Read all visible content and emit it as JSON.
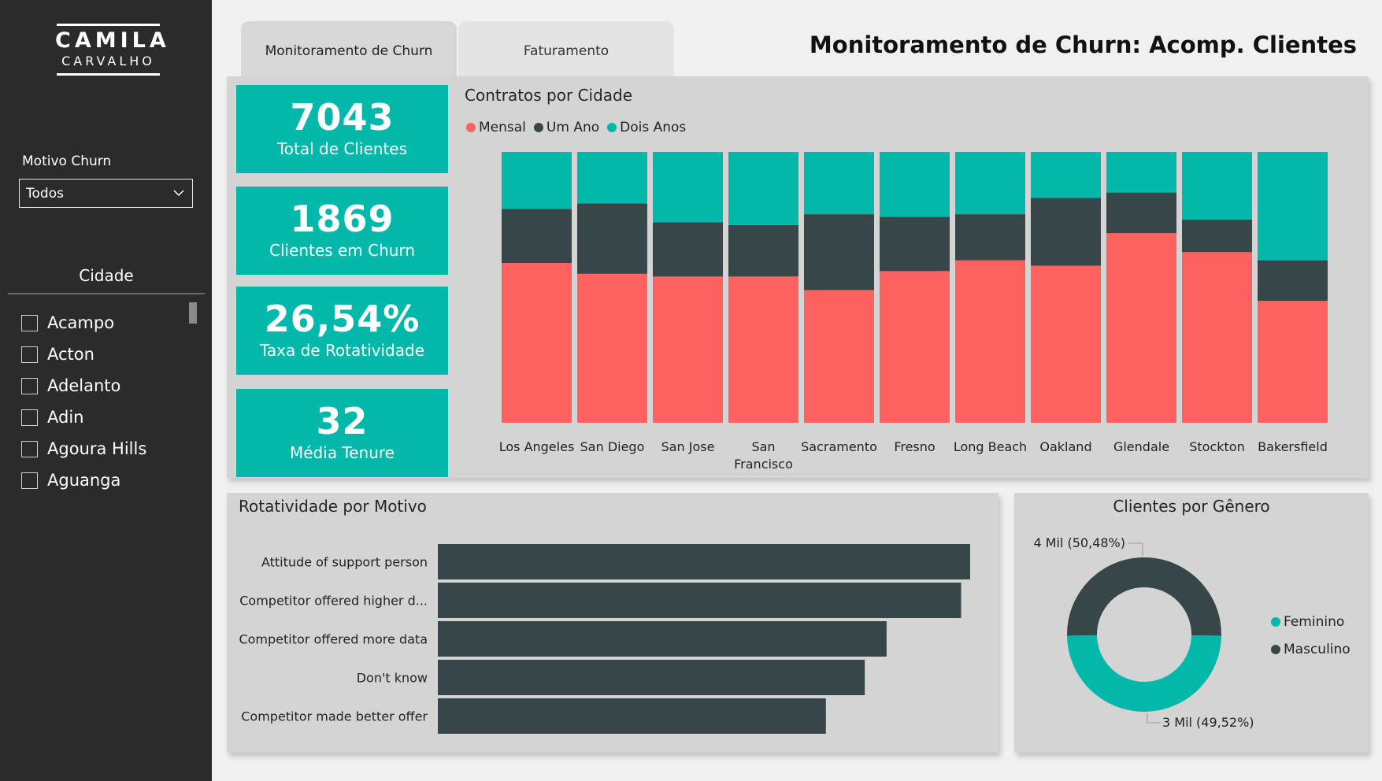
{
  "logo": {
    "line1": "CAMILA",
    "line2": "CARVALHO"
  },
  "filters": {
    "motivo_label": "Motivo Churn",
    "motivo_value": "Todos",
    "cidade_title": "Cidade",
    "cities": [
      "Acampo",
      "Acton",
      "Adelanto",
      "Adin",
      "Agoura Hills",
      "Aguanga"
    ]
  },
  "tabs": [
    {
      "label": "Monitoramento de Churn",
      "active": true
    },
    {
      "label": "Faturamento",
      "active": false
    }
  ],
  "page_title": "Monitoramento de Churn: Acomp. Clientes",
  "kpis": [
    {
      "value": "7043",
      "label": "Total de Clientes"
    },
    {
      "value": "1869",
      "label": "Clientes em Churn"
    },
    {
      "value": "26,54%",
      "label": "Taxa de Rotatividade"
    },
    {
      "value": "32",
      "label": "Média Tenure"
    }
  ],
  "colors": {
    "mensal": "#fd625e",
    "um_ano": "#374649",
    "dois_anos": "#01b8aa",
    "kpi": "#01b8aa",
    "sidebar": "#2b2b2b"
  },
  "chart_data": [
    {
      "type": "bar",
      "stacked": "100%",
      "title": "Contratos por Cidade",
      "legend_position": "top-left",
      "categories": [
        "Los Angeles",
        "San Diego",
        "San Jose",
        "San Francisco",
        "Sacramento",
        "Fresno",
        "Long Beach",
        "Oakland",
        "Glendale",
        "Stockton",
        "Bakersfield"
      ],
      "series": [
        {
          "name": "Mensal",
          "color": "#fd625e",
          "values": [
            59,
            55,
            54,
            54,
            49,
            56,
            60,
            58,
            70,
            63,
            45
          ]
        },
        {
          "name": "Um Ano",
          "color": "#374649",
          "values": [
            20,
            26,
            20,
            19,
            28,
            20,
            17,
            25,
            15,
            12,
            15
          ]
        },
        {
          "name": "Dois Anos",
          "color": "#01b8aa",
          "values": [
            21,
            19,
            26,
            27,
            23,
            24,
            23,
            17,
            15,
            25,
            40
          ]
        }
      ],
      "ylim": [
        0,
        100
      ],
      "grid": false
    },
    {
      "type": "bar",
      "orientation": "horizontal",
      "title": "Rotatividade por Motivo",
      "categories": [
        "Attitude of support person",
        "Competitor offered higher d...",
        "Competitor offered more data",
        "Don't know",
        "Competitor made better offer"
      ],
      "values": [
        100,
        98.3,
        84.3,
        80.2,
        72.9
      ],
      "color": "#374649"
    },
    {
      "type": "pie",
      "donut": true,
      "title": "Clientes por Gênero",
      "legend_position": "right",
      "slices": [
        {
          "name": "Masculino",
          "value": 50.48,
          "color": "#374649",
          "label": "4 Mil (50,48%)"
        },
        {
          "name": "Feminino",
          "value": 49.52,
          "color": "#01b8aa",
          "label": "3 Mil (49,52%)"
        }
      ],
      "legend": [
        "Feminino",
        "Masculino"
      ]
    }
  ]
}
